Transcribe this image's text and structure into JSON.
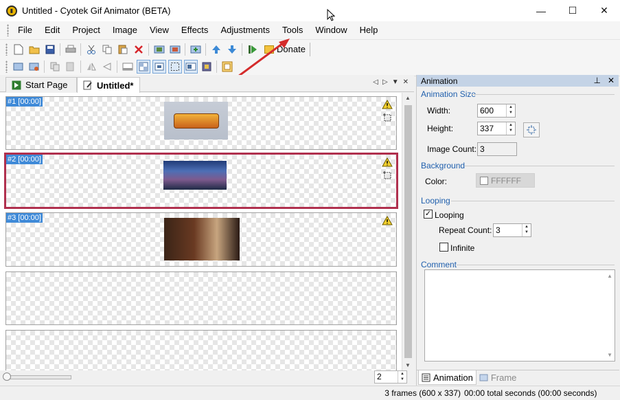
{
  "window": {
    "title": "Untitled - Cyotek Gif Animator (BETA)",
    "minimize": "—",
    "maximize": "☐",
    "close": "✕"
  },
  "menu": [
    "File",
    "Edit",
    "Project",
    "Image",
    "View",
    "Effects",
    "Adjustments",
    "Tools",
    "Window",
    "Help"
  ],
  "toolbar": {
    "donate_label": "Donate"
  },
  "tabs": {
    "start_page": "Start Page",
    "document": "Untitled*"
  },
  "frames": [
    {
      "label": "#1 [00:00]"
    },
    {
      "label": "#2 [00:00]"
    },
    {
      "label": "#3 [00:00]"
    }
  ],
  "zoom": {
    "value": "2"
  },
  "panel": {
    "title": "Animation",
    "animation_size": "Animation Size",
    "width_label": "Width:",
    "width_value": "600",
    "height_label": "Height:",
    "height_value": "337",
    "image_count_label": "Image Count:",
    "image_count_value": "3",
    "background": "Background",
    "color_label": "Color:",
    "color_value": "FFFFFF",
    "looping": "Looping",
    "looping_checkbox": "Looping",
    "repeat_count_label": "Repeat Count:",
    "repeat_count_value": "3",
    "infinite_label": "Infinite",
    "comment": "Comment",
    "tab_animation": "Animation",
    "tab_frame": "Frame"
  },
  "status": {
    "frames": "3 frames (600 x 337)",
    "time": "00:00 total seconds (00:00 seconds)"
  },
  "colors": {
    "accent": "#3f8ad8",
    "selection_border": "#b0304e",
    "panel_header": "#c4d3e6",
    "section_title": "#1f5fad",
    "annotation_arrow": "#d42b2b"
  }
}
